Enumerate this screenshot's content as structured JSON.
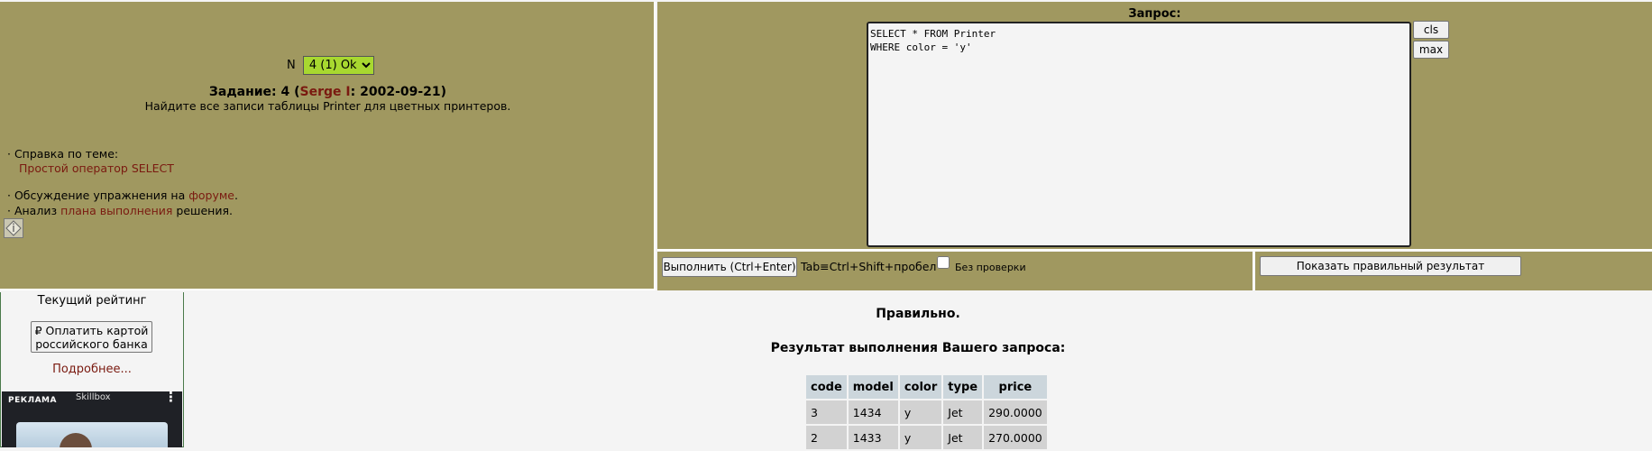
{
  "task": {
    "n_label": "N",
    "selected_option": "4 (1) Ok",
    "title_prefix": "Задание: 4 (",
    "author": "Serge I",
    "date": ": 2002-09-21)",
    "description": "Найдите все записи таблицы Printer для цветных принтеров."
  },
  "info": {
    "help_label": "· Справка по теме:",
    "help_link": "Простой оператор SELECT",
    "forum_prefix": "· Обсуждение упражнения на ",
    "forum_link": "форуме",
    "forum_suffix": ".",
    "plan_prefix": "· Анализ ",
    "plan_link": "плана выполнения",
    "plan_suffix": " решения."
  },
  "query": {
    "label": "Запрос:",
    "text": "SELECT * FROM Printer\nWHERE color = 'y'",
    "cls_label": "cls",
    "max_label": "max"
  },
  "exec": {
    "button_label": "Выполнить (Ctrl+Enter)",
    "hint": "Tab≡Ctrl+Shift+пробел",
    "nocheck_label": "Без  проверки",
    "show_button_label": "Показать правильный результат"
  },
  "sidebar": {
    "rating_title": "Текущий рейтинг",
    "pay_button_label": "₽ Оплатить картой российского банка",
    "more_link": "Подробнее...",
    "ad_label": "РЕКЛАМА",
    "ad_brand": "Skillbox"
  },
  "result": {
    "status": "Правильно.",
    "title": "Результат выполнения Вашего запроса:",
    "columns": [
      "code",
      "model",
      "color",
      "type",
      "price"
    ],
    "rows": [
      [
        "3",
        "1434",
        "y",
        "Jet",
        "290.0000"
      ],
      [
        "2",
        "1433",
        "y",
        "Jet",
        "270.0000"
      ]
    ]
  }
}
